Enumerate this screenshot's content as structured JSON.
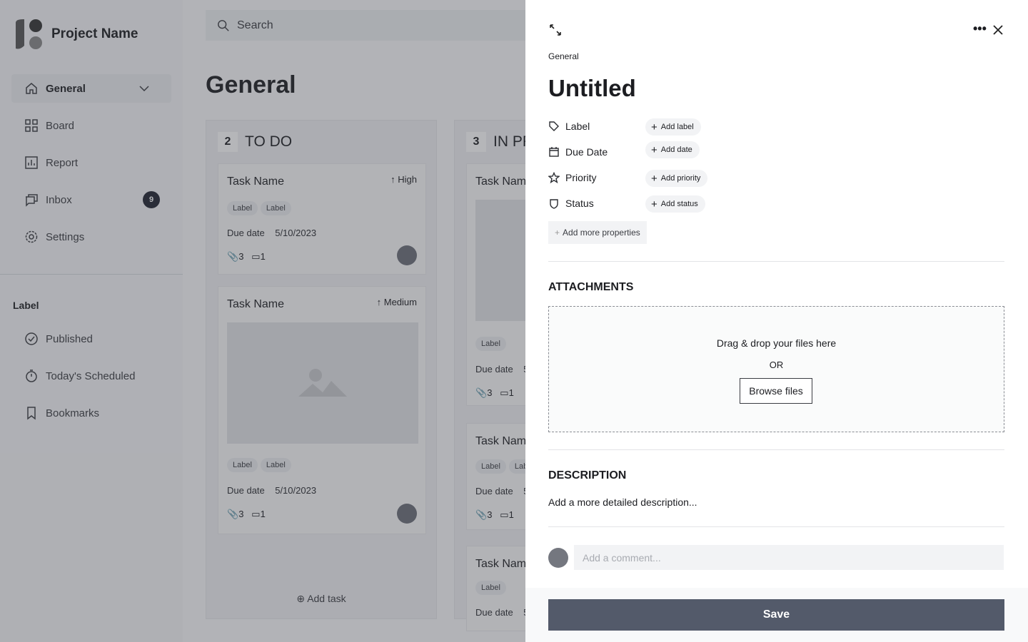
{
  "sidebar": {
    "project_name": "Project Name",
    "nav": [
      {
        "label": "General",
        "icon": "home-icon"
      },
      {
        "label": "Board",
        "icon": "grid-icon"
      },
      {
        "label": "Report",
        "icon": "chart-icon"
      },
      {
        "label": "Inbox",
        "icon": "inbox-icon",
        "badge": "9"
      },
      {
        "label": "Settings",
        "icon": "gear-icon"
      }
    ],
    "section_title": "Label",
    "labels": [
      {
        "label": "Published",
        "icon": "check-circle-icon"
      },
      {
        "label": "Today's Scheduled",
        "icon": "timer-icon"
      },
      {
        "label": "Bookmarks",
        "icon": "bookmark-icon"
      }
    ]
  },
  "search": {
    "placeholder": "Search"
  },
  "main": {
    "title": "General",
    "columns": [
      {
        "count": "2",
        "title": "TO DO",
        "add_task": "Add task",
        "cards": [
          {
            "name": "Task Name",
            "priority": "High",
            "labels": [
              "Label",
              "Label"
            ],
            "due_label": "Due date",
            "due": "5/10/2023",
            "attachments": "3",
            "comments": "1"
          },
          {
            "name": "Task Name",
            "priority": "Medium",
            "labels": [
              "Label",
              "Label"
            ],
            "due_label": "Due date",
            "due": "5/10/2023",
            "attachments": "3",
            "comments": "1"
          }
        ]
      },
      {
        "count": "3",
        "title": "IN PR",
        "cards": [
          {
            "name": "Task Name",
            "labels": [
              "Label"
            ],
            "due_label": "Due date",
            "due": "5/",
            "attachments": "3",
            "comments": "1"
          },
          {
            "name": "Task Name",
            "labels": [
              "Label",
              "Lab"
            ],
            "due_label": "Due date",
            "due": "5/",
            "attachments": "3",
            "comments": "1"
          },
          {
            "name": "Task Name",
            "labels": [
              "Label"
            ],
            "due_label": "Due date",
            "due": "5/"
          }
        ]
      }
    ]
  },
  "panel": {
    "breadcrumb": "General",
    "title": "Untitled",
    "properties": [
      {
        "label": "Label",
        "action": "Add label",
        "icon": "tag-icon"
      },
      {
        "label": "Due Date",
        "action": "Add date",
        "icon": "calendar-icon"
      },
      {
        "label": "Priority",
        "action": "Add priority",
        "icon": "star-icon"
      },
      {
        "label": "Status",
        "action": "Add status",
        "icon": "shield-icon"
      }
    ],
    "add_more": "Add more properties",
    "attachments_title": "ATTACHMENTS",
    "drop_text": "Drag & drop your files here",
    "or": "OR",
    "browse": "Browse files",
    "description_title": "DESCRIPTION",
    "description_placeholder": "Add a more detailed description...",
    "comment_placeholder": "Add a comment...",
    "save": "Save"
  }
}
